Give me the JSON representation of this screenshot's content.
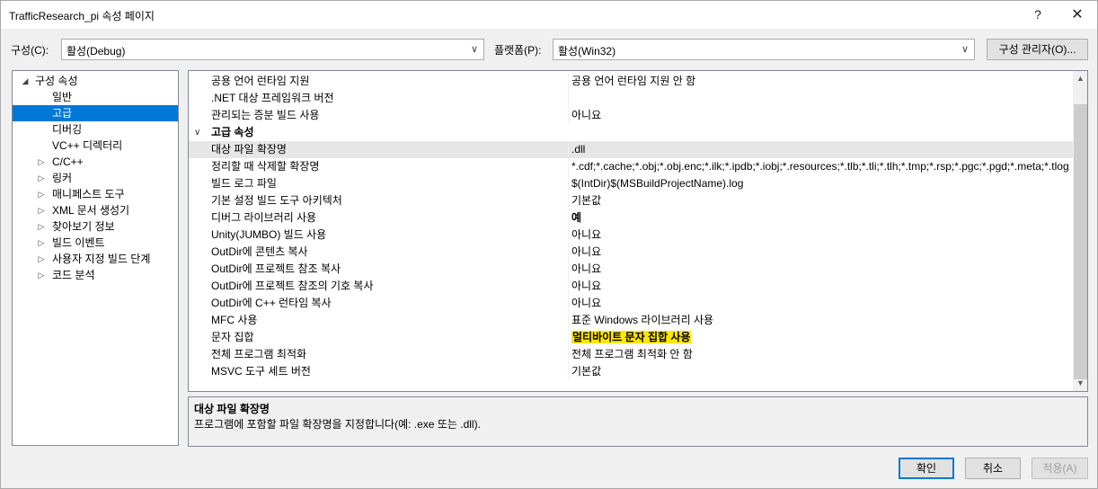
{
  "window": {
    "title": "TrafficResearch_pi 속성 페이지",
    "help_glyph": "?",
    "close_glyph": "✕"
  },
  "config": {
    "config_label": "구성(C):",
    "config_value": "활성(Debug)",
    "platform_label": "플랫폼(P):",
    "platform_value": "활성(Win32)",
    "manager_button": "구성 관리자(O)..."
  },
  "tree": {
    "root": "구성 속성",
    "items": [
      "일반",
      "고급",
      "디버깅",
      "VC++ 디렉터리",
      "C/C++",
      "링커",
      "매니페스트 도구",
      "XML 문서 생성기",
      "찾아보기 정보",
      "빌드 이벤트",
      "사용자 지정 빌드 단계",
      "코드 분석"
    ],
    "selected": "고급"
  },
  "grid": {
    "rows": [
      {
        "name": "공용 언어 런타임 지원",
        "value": "공용 언어 런타임 지원 안 함"
      },
      {
        "name": ".NET 대상 프레임워크 버전",
        "value": ""
      },
      {
        "name": "관리되는 증분 빌드 사용",
        "value": "아니요"
      },
      {
        "category": "고급 속성"
      },
      {
        "name": "대상 파일 확장명",
        "value": ".dll"
      },
      {
        "name": "정리할 때 삭제할 확장명",
        "value": "*.cdf;*.cache;*.obj;*.obj.enc;*.ilk;*.ipdb;*.iobj;*.resources;*.tlb;*.tli;*.tlh;*.tmp;*.rsp;*.pgc;*.pgd;*.meta;*.tlog"
      },
      {
        "name": "빌드 로그 파일",
        "value": "$(IntDir)$(MSBuildProjectName).log"
      },
      {
        "name": "기본 설정 빌드 도구 아키텍처",
        "value": "기본값"
      },
      {
        "name": "디버그 라이브러리 사용",
        "value": "예"
      },
      {
        "name": "Unity(JUMBO) 빌드 사용",
        "value": "아니요"
      },
      {
        "name": "OutDir에 콘텐츠 복사",
        "value": "아니요"
      },
      {
        "name": "OutDir에 프로젝트 참조 복사",
        "value": "아니요"
      },
      {
        "name": "OutDir에 프로젝트 참조의 기호 복사",
        "value": "아니요"
      },
      {
        "name": "OutDir에 C++ 런타임 복사",
        "value": "아니요"
      },
      {
        "name": "MFC 사용",
        "value": "표준 Windows 라이브러리 사용"
      },
      {
        "name": "문자 집합",
        "value": "멀티바이트 문자 집합 사용"
      },
      {
        "name": "전체 프로그램 최적화",
        "value": "전체 프로그램 최적화 안 함"
      },
      {
        "name": "MSVC 도구 세트 버전",
        "value": "기본값"
      }
    ]
  },
  "description": {
    "title": "대상 파일 확장명",
    "text": "프로그램에 포함할 파일 확장명을 지정합니다(예: .exe 또는 .dll)."
  },
  "buttons": {
    "ok": "확인",
    "cancel": "취소",
    "apply": "적용(A)"
  },
  "colors": {
    "selection": "#0078d7",
    "highlight": "#ffe600"
  }
}
